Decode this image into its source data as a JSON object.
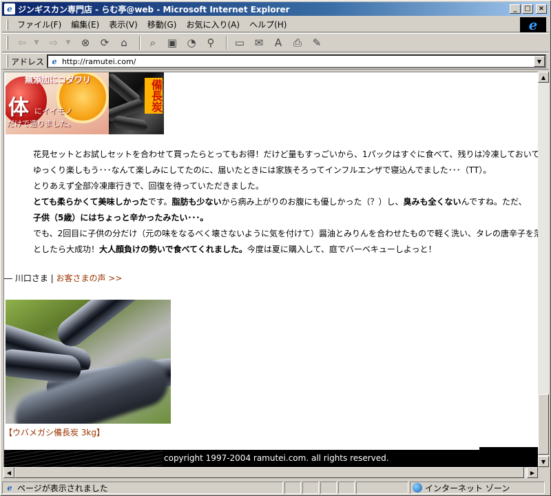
{
  "window": {
    "title": "ジンギスカン専門店 - らむ亭@web - Microsoft Internet Explorer",
    "minimize": "_",
    "maximize": "□",
    "close": "×"
  },
  "menu": {
    "items": [
      "ファイル(F)",
      "編集(E)",
      "表示(V)",
      "移動(G)",
      "お気に入り(A)",
      "ヘルプ(H)"
    ]
  },
  "toolbar": {
    "buttons": [
      "back",
      "forward",
      "stop",
      "refresh",
      "home",
      "search",
      "favorites",
      "history",
      "channels",
      "fullscreen",
      "mail",
      "font",
      "print",
      "edit"
    ]
  },
  "address": {
    "label": "アドレス",
    "url": "http://ramutei.com/"
  },
  "banner_left": {
    "line1": "無添加にコダワリ",
    "big": "体",
    "line2": "にイイモノ",
    "line3": "だけで造りました。"
  },
  "banner_right": {
    "text": "備長炭"
  },
  "content": {
    "p1": "花見セットとお試しセットを合わせて買ったらとってもお得！だけど量もすっごいから、1パックはすぐに食べて、残りは冷凍しておいて",
    "p2": "ゆっくり楽しもう･･･なんて楽しみにしてたのに、届いたときには家族そろってインフルエンザで寝込んでました･･･（TT）。",
    "p3": "とりあえず全部冷凍庫行きで、回復を待っていただきました。",
    "p4_b1": "とても柔らかくて美味しかった",
    "p4_t1": "です。",
    "p4_b2": "脂肪も少ない",
    "p4_t2": "から病み上がりのお腹にも優しかった（？）し、",
    "p4_b3": "臭みも全くない",
    "p4_t3": "んですね。ただ、",
    "p5_b": "子供（5歳）にはちょっと辛かったみたい･･･。",
    "p6": "でも、2回目に子供の分だけ（元の味をなるべく壊さないように気を付けて）醤油とみりんを合わせたもので軽く洗い、タレの唐辛子を落",
    "p7_t1": "としたら大成功！",
    "p7_b": "大人顔負けの勢いで食べてくれました。",
    "p7_t2": "今度は夏に購入して、庭でバーベキューしよっと！",
    "signature": "― 川口さま | ",
    "sig_link": "お客さまの声 >>",
    "caption_link": "【ウバメガシ備長炭 3kg】"
  },
  "footer": {
    "copyright": "copyright 1997-2004 ramutei.com. all rights reserved."
  },
  "status": {
    "text": "ページが表示されました",
    "zone": "インターネット ゾーン"
  }
}
